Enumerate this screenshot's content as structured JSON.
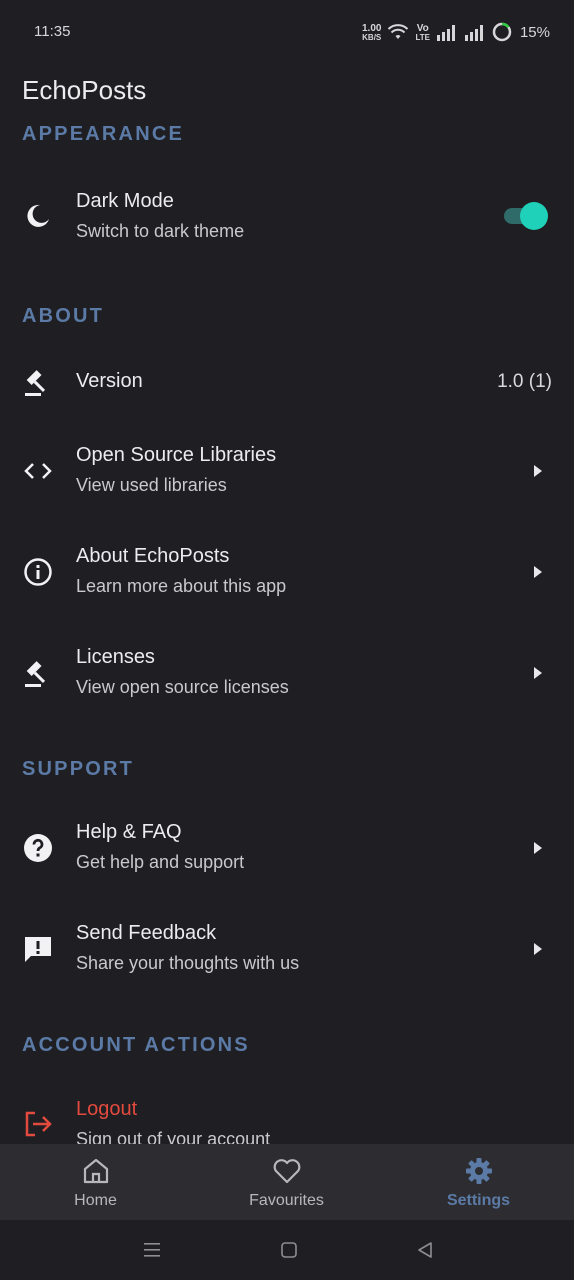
{
  "status_bar": {
    "time": "11:35",
    "speed_value": "1.00",
    "speed_unit": "KB/S",
    "volte_top": "Vo",
    "volte_bottom": "LTE",
    "battery": "15%"
  },
  "app": {
    "title": "EchoPosts"
  },
  "sections": {
    "appearance": "APPEARANCE",
    "about": "ABOUT",
    "support": "SUPPORT",
    "account": "ACCOUNT ACTIONS"
  },
  "rows": {
    "dark_mode": {
      "title": "Dark Mode",
      "subtitle": "Switch to dark theme",
      "enabled": true
    },
    "version": {
      "title": "Version",
      "value": "1.0 (1)"
    },
    "open_source": {
      "title": "Open Source Libraries",
      "subtitle": "View used libraries"
    },
    "about_app": {
      "title": "About EchoPosts",
      "subtitle": "Learn more about this app"
    },
    "licenses": {
      "title": "Licenses",
      "subtitle": "View open source licenses"
    },
    "help": {
      "title": "Help & FAQ",
      "subtitle": "Get help and support"
    },
    "feedback": {
      "title": "Send Feedback",
      "subtitle": "Share your thoughts with us"
    },
    "logout": {
      "title": "Logout",
      "subtitle": "Sign out of your account"
    }
  },
  "bottom_nav": {
    "items": [
      {
        "label": "Home",
        "icon": "home-icon"
      },
      {
        "label": "Favourites",
        "icon": "heart-icon"
      },
      {
        "label": "Settings",
        "icon": "gear-icon",
        "active": true
      }
    ]
  },
  "colors": {
    "background": "#1f1f23",
    "accent": "#5b7aa6",
    "toggle_on": "#1fd1b8",
    "danger": "#e34a3e"
  }
}
